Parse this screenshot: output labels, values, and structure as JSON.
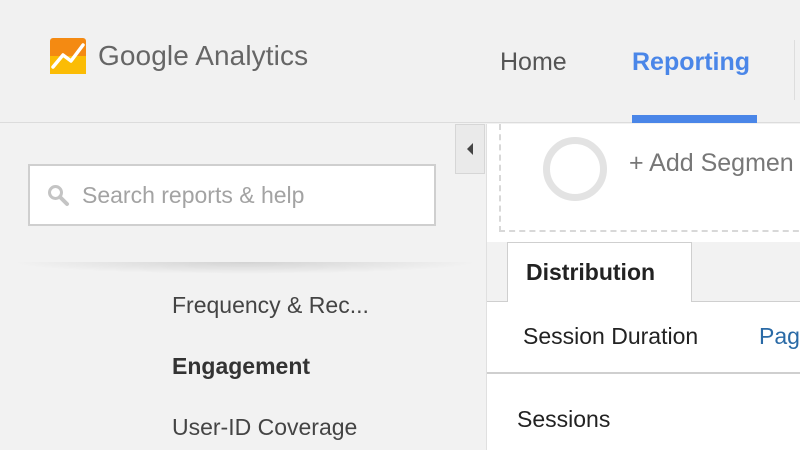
{
  "header": {
    "brand": "Google Analytics",
    "nav": {
      "home": "Home",
      "reporting": "Reporting"
    }
  },
  "sidebar": {
    "search": {
      "placeholder": "Search reports & help",
      "value": ""
    },
    "items": [
      {
        "label": "Frequency & Rec...",
        "active": false
      },
      {
        "label": "Engagement",
        "active": true
      },
      {
        "label": "User-ID Coverage",
        "active": false
      }
    ]
  },
  "main": {
    "segment": {
      "add_label": "+ Add Segmen"
    },
    "tabs": {
      "active": "Distribution"
    },
    "subtabs": {
      "session_duration": "Session Duration",
      "page_depth": "Pag"
    },
    "table": {
      "column_header": "Sessions"
    }
  },
  "colors": {
    "accent": "#4a86e8",
    "logo_orange": "#f48a12",
    "logo_yellow": "#fbbc05",
    "link": "#2a6aa6"
  },
  "icons": [
    "google-analytics-logo-icon",
    "search-icon",
    "collapse-left-icon",
    "segment-circle-icon"
  ]
}
